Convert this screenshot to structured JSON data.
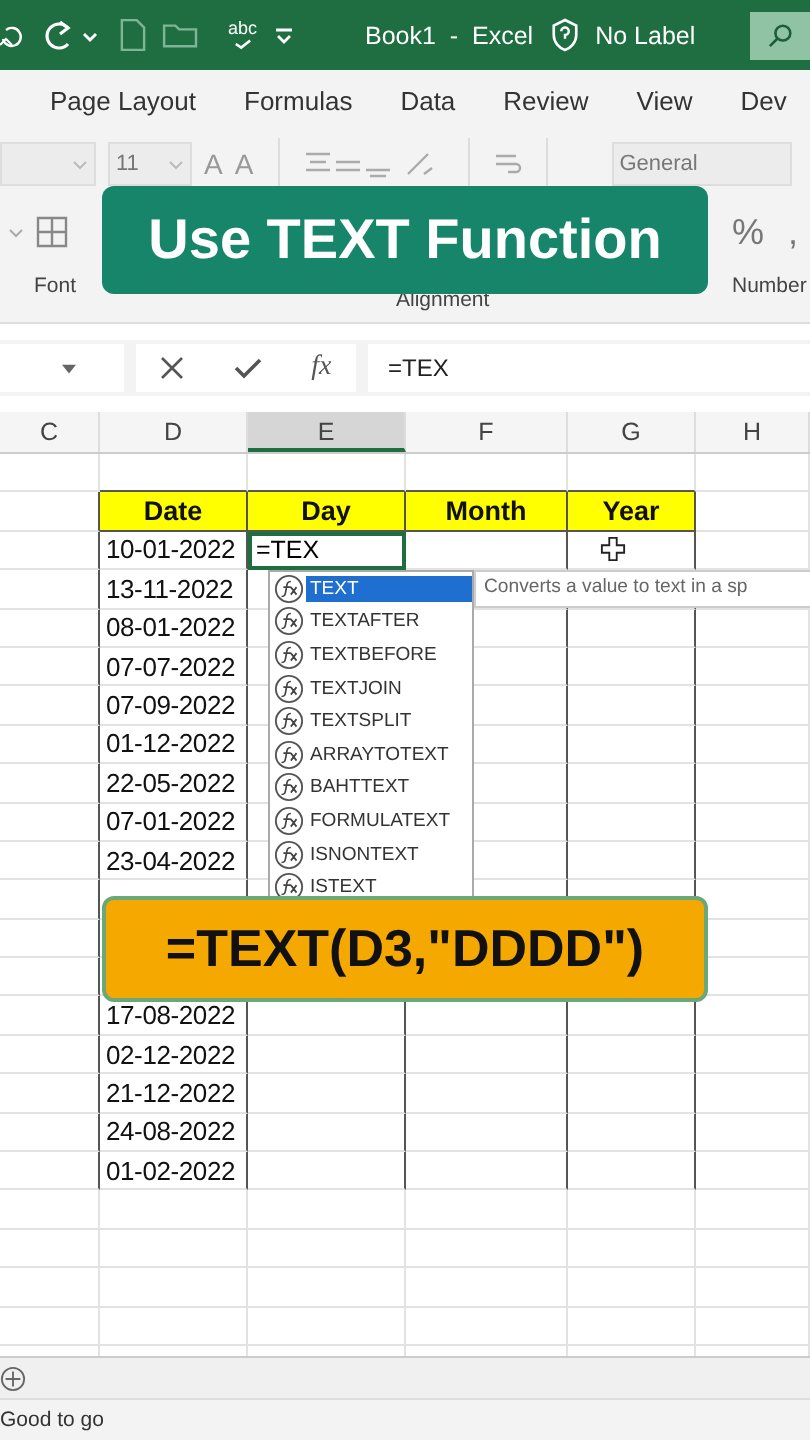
{
  "title_bar": {
    "spelling": "abc",
    "title": "Book1  -  Excel",
    "label": "No Label"
  },
  "ribbon_tabs": [
    "Page Layout",
    "Formulas",
    "Data",
    "Review",
    "View",
    "Dev"
  ],
  "ribbon": {
    "font_size": "11",
    "font_buttons": [
      "A",
      "A"
    ],
    "number_format": "General",
    "number_buttons": [
      "%",
      ","
    ],
    "groups": [
      "Font",
      "Alignment",
      "Number"
    ]
  },
  "formula_bar": {
    "insert_function": "fx",
    "formula": "=TEX"
  },
  "columns": [
    {
      "label": "C",
      "selected": false
    },
    {
      "label": "D",
      "selected": false
    },
    {
      "label": "E",
      "selected": true
    },
    {
      "label": "F",
      "selected": false
    },
    {
      "label": "G",
      "selected": false
    },
    {
      "label": "H",
      "selected": false
    }
  ],
  "table": {
    "headers": [
      "Date",
      "Day",
      "Month",
      "Year"
    ],
    "active_cell": "=TEX",
    "dates_above": [
      "10-01-2022",
      "13-11-2022",
      "08-01-2022",
      "07-07-2022",
      "07-09-2022",
      "01-12-2022",
      "22-05-2022",
      "07-01-2022",
      "23-04-2022"
    ],
    "dates_below": [
      "17-08-2022",
      "02-12-2022",
      "21-12-2022",
      "24-08-2022",
      "01-02-2022"
    ]
  },
  "autocomplete": {
    "items": [
      {
        "label": "TEXT",
        "selected": true
      },
      {
        "label": "TEXTAFTER",
        "selected": false
      },
      {
        "label": "TEXTBEFORE",
        "selected": false
      },
      {
        "label": "TEXTJOIN",
        "selected": false
      },
      {
        "label": "TEXTSPLIT",
        "selected": false
      },
      {
        "label": "ARRAYTOTEXT",
        "selected": false
      },
      {
        "label": "BAHTTEXT",
        "selected": false
      },
      {
        "label": "FORMULATEXT",
        "selected": false
      },
      {
        "label": "ISNONTEXT",
        "selected": false
      },
      {
        "label": "ISTEXT",
        "selected": false
      }
    ],
    "tooltip": "Converts a value to text in a sp"
  },
  "captions": [
    {
      "kind": "title",
      "text": "Use TEXT Function"
    },
    {
      "kind": "formula",
      "text": "=TEXT(D3,\"DDDD\")"
    }
  ],
  "status_bar": {
    "text": "Good to go"
  }
}
